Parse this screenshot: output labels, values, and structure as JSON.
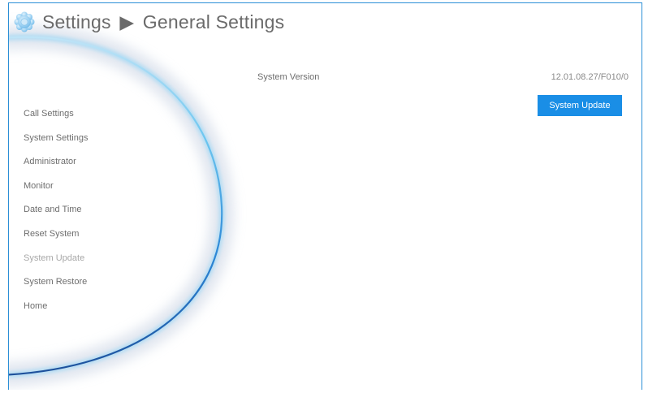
{
  "header": {
    "title_part1": "Settings",
    "separator": "▶",
    "title_part2": "General Settings",
    "icon": "gear-flower-icon"
  },
  "sidebar": {
    "items": [
      {
        "label": "Call Settings"
      },
      {
        "label": "System Settings"
      },
      {
        "label": "Administrator"
      },
      {
        "label": "Monitor"
      },
      {
        "label": "Date and Time"
      },
      {
        "label": "Reset System"
      },
      {
        "label": "System Update",
        "active": true
      },
      {
        "label": "System Restore"
      },
      {
        "label": "Home"
      }
    ]
  },
  "main": {
    "version_label": "System Version",
    "version_value": "12.01.08.27/F010/0",
    "update_button": "System Update"
  },
  "colors": {
    "accent": "#1a8ee6",
    "border": "#2b8fd6",
    "text": "#6e6e6e",
    "active_text": "#a8a8a8"
  }
}
